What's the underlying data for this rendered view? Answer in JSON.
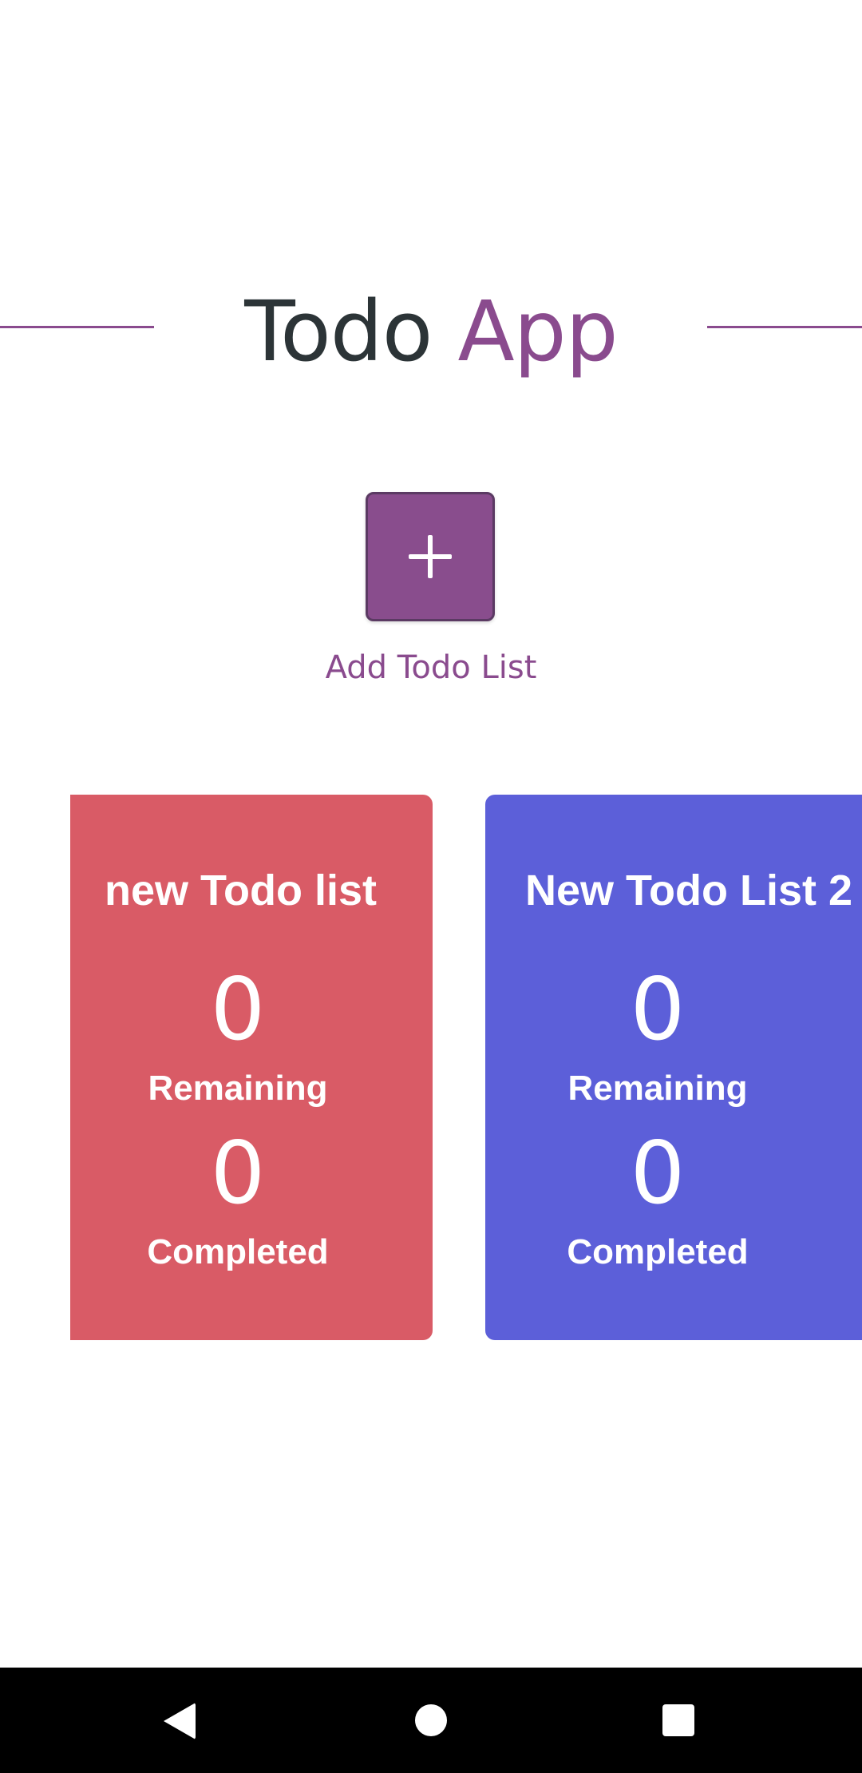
{
  "header": {
    "title_main": "Todo",
    "title_accent": "App"
  },
  "add_list": {
    "icon": "plus-icon",
    "label": "Add Todo List"
  },
  "cards": [
    {
      "title": "new Todo list",
      "remaining_count": "0",
      "remaining_label": "Remaining",
      "completed_count": "0",
      "completed_label": "Completed",
      "color": "#d95b66"
    },
    {
      "title": "New Todo List 2",
      "remaining_count": "0",
      "remaining_label": "Remaining",
      "completed_count": "0",
      "completed_label": "Completed",
      "color": "#5c5fd9"
    }
  ],
  "nav": {
    "back_icon": "back-triangle-icon",
    "home_icon": "home-circle-icon",
    "recent_icon": "recent-apps-square-icon"
  },
  "colors": {
    "accent": "#8a4b8e",
    "title_text": "#2c3437",
    "button_bg": "#894d8d"
  }
}
